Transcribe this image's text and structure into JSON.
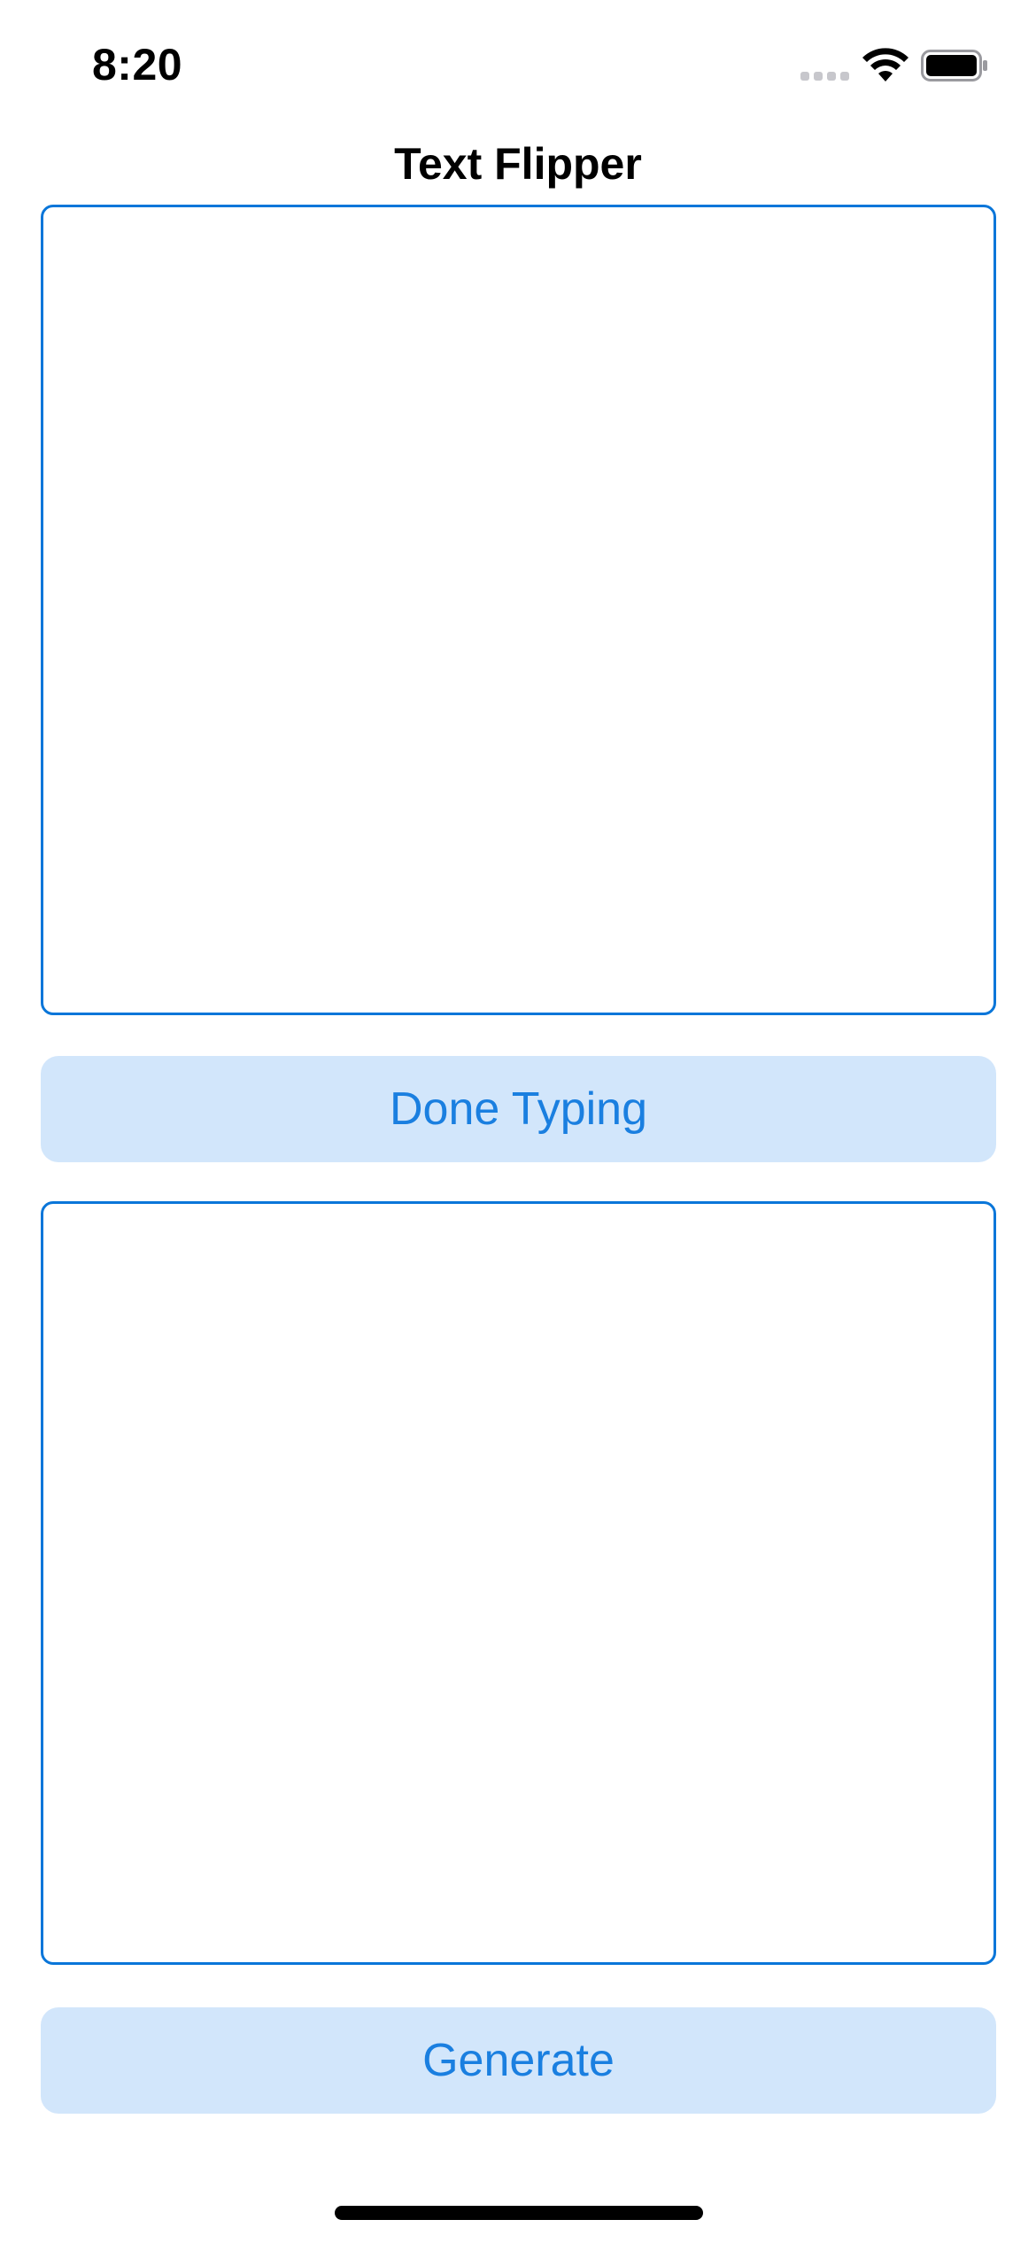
{
  "status_bar": {
    "time": "8:20",
    "icons": [
      "cellular-signal-icon",
      "wifi-icon",
      "battery-icon"
    ]
  },
  "app": {
    "title": "Text Flipper"
  },
  "input": {
    "value": "",
    "placeholder": ""
  },
  "output": {
    "value": "",
    "placeholder": ""
  },
  "buttons": {
    "done_label": "Done Typing",
    "generate_label": "Generate"
  },
  "colors": {
    "accent": "#0A76D9",
    "button_text": "#1A7FE0",
    "button_background": "#D2E6FB",
    "background": "#FFFFFF"
  }
}
